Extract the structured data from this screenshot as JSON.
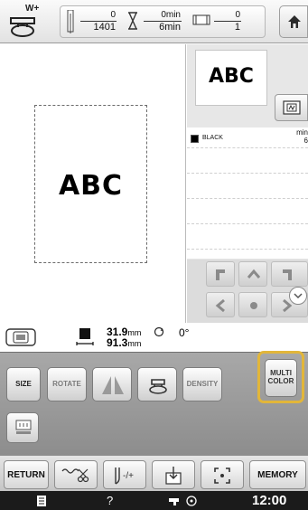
{
  "header": {
    "presser_foot_label": "W+",
    "stitch_current": "0",
    "stitch_total": "1401",
    "time_current": "0min",
    "time_total": "6min",
    "color_current": "0",
    "color_total": "1",
    "home_icon": "home-icon"
  },
  "preview": {
    "hoop_text": "ABC"
  },
  "right_panel": {
    "thumb_text": "ABC",
    "side_button_icon": "embroidery-frame-icon",
    "thread_list": [
      {
        "name": "BLACK",
        "min_label": "min",
        "min_value": "6",
        "color": "#000000"
      }
    ],
    "arrows": [
      "up-left",
      "up",
      "up-right",
      "left",
      "center",
      "right",
      "down-left",
      "down",
      "down-right"
    ]
  },
  "info": {
    "width_value": "31.9",
    "width_unit": "mm",
    "height_value": "91.3",
    "height_unit": "mm",
    "angle": "0°"
  },
  "edit_panel": {
    "size_label": "SIZE",
    "rotate_label": "ROTATE",
    "mirror_icon": "mirror-icon",
    "border_icon": "border-icon",
    "density_label": "DENSITY",
    "multicolor_label": "MULTI COLOR",
    "multicolor_line1": "MULTI",
    "multicolor_line2": "COLOR",
    "multicolor_highlight_color": "#e2b63a",
    "extra_icon": "alignment-icon"
  },
  "bottom_bar": {
    "return_label": "RETURN",
    "thread_cut_icon": "thread-cut-icon",
    "tension_icon": "tension-icon",
    "start_point_icon": "start-point-icon",
    "trial_icon": "trial-frame-icon",
    "memory_label": "MEMORY"
  },
  "status_bar": {
    "doc_icon": "document-icon",
    "help_label": "?",
    "clock": "12:00"
  }
}
